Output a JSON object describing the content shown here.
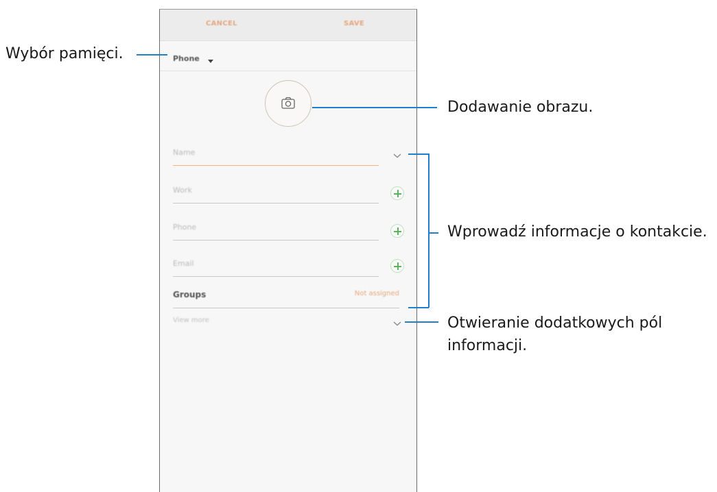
{
  "topbar": {
    "cancel_label": "CANCEL",
    "save_label": "SAVE"
  },
  "storage": {
    "label": "Phone"
  },
  "photo": {
    "icon": "camera-icon"
  },
  "fields": {
    "name_placeholder": "Name",
    "work_placeholder": "Work",
    "phone_placeholder": "Phone",
    "email_placeholder": "Email"
  },
  "groups": {
    "label": "Groups",
    "value": "Not assigned"
  },
  "view_more": {
    "label": "View more"
  },
  "callouts": {
    "storage": "Wybór pamięci.",
    "image": "Dodawanie obrazu.",
    "info": "Wprowadź informacje o kontakcie.",
    "more_line1": "Otwieranie dodatkowych pól",
    "more_line2": "informacji."
  },
  "colors": {
    "accent": "#e6a77e",
    "plus": "#58b65a",
    "callout_line": "#1e7fd0"
  }
}
